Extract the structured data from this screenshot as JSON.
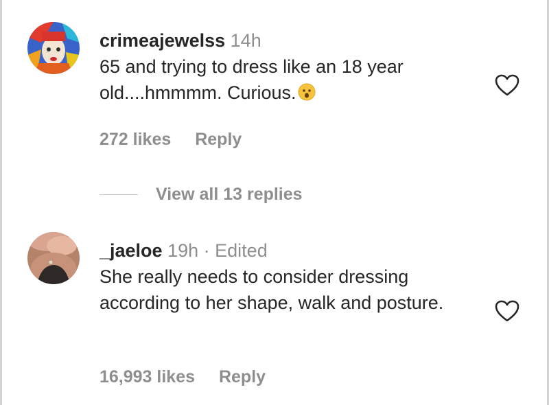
{
  "comments": [
    {
      "username": "crimeajewelss",
      "timestamp": "14h",
      "edited_label": "",
      "text": "65 and trying to dress like an 18 year old....hmmmm. Curious.",
      "emoji": "hushed-face-emoji",
      "likes": "272 likes",
      "reply_label": "Reply",
      "avatar_icon": "avatar-colorful-portrait",
      "like_icon": "heart-outline-icon"
    },
    {
      "username": "_jaeloe",
      "timestamp": "19h",
      "edited_label": "· Edited",
      "text": "She really needs to consider dressing according to her shape, walk and posture.",
      "likes": "16,993 likes",
      "reply_label": "Reply",
      "avatar_icon": "avatar-portrait",
      "like_icon": "heart-outline-icon"
    }
  ],
  "replies_toggle": {
    "label": "View all 13 replies"
  },
  "colors": {
    "text_primary": "#262626",
    "text_secondary": "#8e8e8e",
    "divider": "#c7c7c7",
    "background": "#ffffff"
  }
}
